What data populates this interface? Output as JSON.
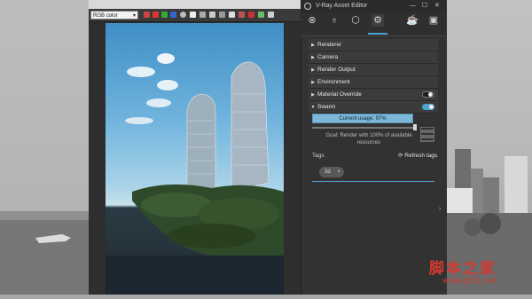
{
  "vfb": {
    "channel": "RGB color"
  },
  "editor": {
    "title": "V-Ray Asset Editor",
    "window_buttons": {
      "minimize": "—",
      "maximize": "☐",
      "close": "✕"
    },
    "sections": [
      {
        "label": "Renderer"
      },
      {
        "label": "Camera"
      },
      {
        "label": "Render Output"
      },
      {
        "label": "Environment"
      },
      {
        "label": "Material Override",
        "toggle": "off"
      },
      {
        "label": "Swarm",
        "toggle": "on",
        "expanded": true
      }
    ],
    "swarm": {
      "usage_label": "Current usage: 97%",
      "usage_percent": 97,
      "goal_text": "Goal: Render with 100% of available resources",
      "goal_fraction": 1.0
    },
    "tags": {
      "label": "Tags",
      "refresh_label": "Refresh tags",
      "chip": "3d",
      "chip_remove": "×"
    },
    "accent": "#4fa3d1"
  },
  "watermark": {
    "title": "脚本之家",
    "url": "www.jb51.net"
  }
}
